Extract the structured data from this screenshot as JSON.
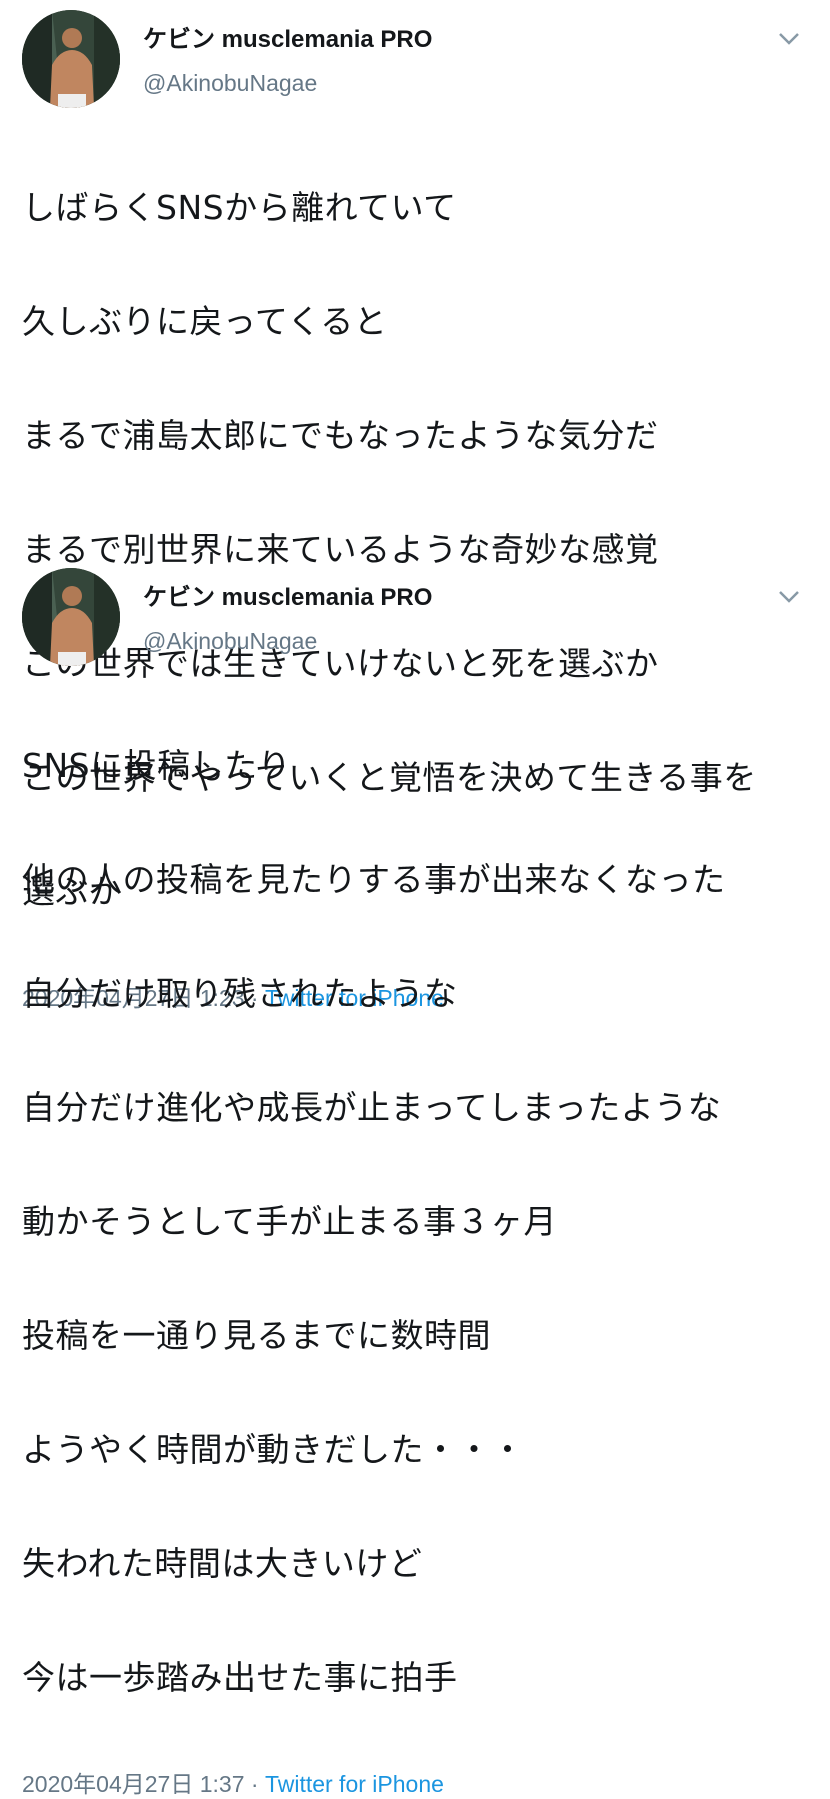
{
  "tweets": [
    {
      "name": "ケビン musclemania PRO",
      "handle": "@AkinobuNagae",
      "lines": [
        "しばらくSNSから離れていて",
        "久しぶりに戻ってくると",
        "まるで浦島太郎にでもなったような気分だ",
        "まるで別世界に来ているような奇妙な感覚",
        "この世界では生きていけないと死を選ぶか",
        "この世界でやっていくと覚悟を決めて生きる事を",
        "選ぶか"
      ],
      "timestamp": "2020年04月27日 1:23 · ",
      "source": "Twitter for iPhone"
    },
    {
      "name": "ケビン musclemania PRO",
      "handle": "@AkinobuNagae",
      "lines": [
        "SNSに投稿したり",
        "他の人の投稿を見たりする事が出来なくなった",
        "自分だけ取り残されたような",
        "自分だけ進化や成長が止まってしまったような",
        "動かそうとして手が止まる事３ヶ月",
        "投稿を一通り見るまでに数時間",
        "ようやく時間が動きだした・・・",
        "失われた時間は大きいけど",
        "今は一歩踏み出せた事に拍手"
      ],
      "timestamp": "2020年04月27日 1:37 · ",
      "source": "Twitter for iPhone"
    }
  ],
  "icons": {
    "menu": "chevron-down-icon",
    "avatar": "profile-photo"
  },
  "colors": {
    "text": "#14171a",
    "secondary": "#657786",
    "link": "#1b95e0"
  }
}
